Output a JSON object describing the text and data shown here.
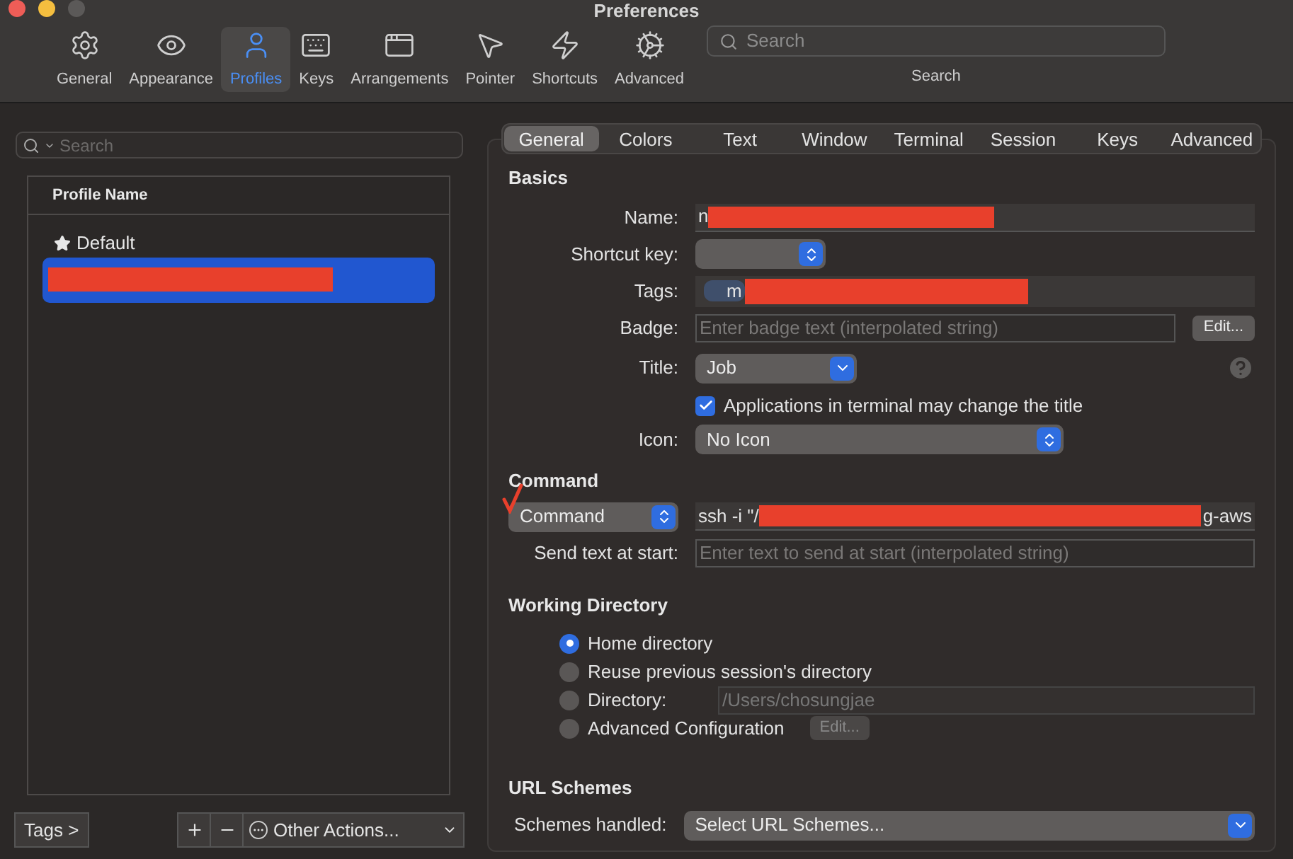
{
  "window": {
    "title": "Preferences"
  },
  "toolbar": {
    "items": [
      {
        "kind": "general",
        "label": "General",
        "selected": false
      },
      {
        "kind": "appearance",
        "label": "Appearance",
        "selected": false
      },
      {
        "kind": "profiles",
        "label": "Profiles",
        "selected": true
      },
      {
        "kind": "keys",
        "label": "Keys",
        "selected": false
      },
      {
        "kind": "arrangements",
        "label": "Arrangements",
        "selected": false
      },
      {
        "kind": "pointer",
        "label": "Pointer",
        "selected": false
      },
      {
        "kind": "shortcuts",
        "label": "Shortcuts",
        "selected": false
      },
      {
        "kind": "advanced",
        "label": "Advanced",
        "selected": false
      }
    ],
    "search": {
      "placeholder": "Search",
      "label": "Search"
    }
  },
  "profiles": {
    "search": {
      "placeholder": "Search"
    },
    "column": "Profile Name",
    "rows": [
      {
        "kind": "default",
        "label": "Default",
        "selected": false
      },
      {
        "kind": "redacted",
        "selected": true
      }
    ],
    "tags_button": "Tags >",
    "other_actions": "Other Actions..."
  },
  "tabs": [
    {
      "label": "General",
      "selected": true
    },
    {
      "label": "Colors",
      "selected": false
    },
    {
      "label": "Text",
      "selected": false
    },
    {
      "label": "Window",
      "selected": false
    },
    {
      "label": "Terminal",
      "selected": false
    },
    {
      "label": "Session",
      "selected": false
    },
    {
      "label": "Keys",
      "selected": false
    },
    {
      "label": "Advanced",
      "selected": false
    }
  ],
  "basics": {
    "heading": "Basics",
    "name": {
      "label": "Name:",
      "value": "n",
      "redacted": true
    },
    "shortcut": {
      "label": "Shortcut key:"
    },
    "tags": {
      "label": "Tags:",
      "tag": "m",
      "redacted": true
    },
    "badge": {
      "label": "Badge:",
      "placeholder": "Enter badge text (interpolated string)",
      "button": "Edit..."
    },
    "title": {
      "label": "Title:",
      "value": "Job"
    },
    "title_change": {
      "label": "Applications in terminal may change the title",
      "checked": true
    },
    "icon": {
      "label": "Icon:",
      "value": "No Icon"
    }
  },
  "command": {
    "heading": "Command",
    "mode": "Command",
    "annotated": true,
    "value": "ssh -i \"/",
    "redacted": true,
    "value_tail": "g-aws",
    "send_text": {
      "label": "Send text at start:",
      "placeholder": "Enter text to send at start (interpolated string)"
    }
  },
  "working_directory": {
    "heading": "Working Directory",
    "options": [
      {
        "kind": "plain",
        "label": "Home directory",
        "selected": true
      },
      {
        "kind": "plain",
        "label": "Reuse previous session's directory",
        "selected": false
      },
      {
        "kind": "directory",
        "label": "Directory:",
        "value": "/Users/chosungjae",
        "selected": false
      },
      {
        "kind": "advanced",
        "label": "Advanced Configuration",
        "button": "Edit...",
        "selected": false
      }
    ]
  },
  "url_schemes": {
    "heading": "URL Schemes",
    "label": "Schemes handled:",
    "value": "Select URL Schemes..."
  }
}
